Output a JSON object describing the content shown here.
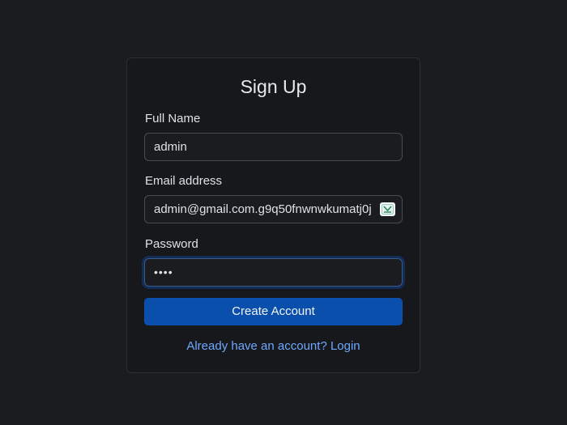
{
  "form": {
    "title": "Sign Up",
    "full_name": {
      "label": "Full Name",
      "value": "admin"
    },
    "email": {
      "label": "Email address",
      "value": "admin@gmail.com.g9q50fnwnwkumatj0j"
    },
    "password": {
      "label": "Password",
      "value": "••••"
    },
    "submit_label": "Create Account",
    "login_link": "Already have an account? Login"
  },
  "icons": {
    "email_field": "autofill-extension-icon"
  },
  "colors": {
    "background": "#1a1c1f",
    "card": "#17181b",
    "primary_button": "#0b4fad",
    "link": "#6ea8fe"
  }
}
